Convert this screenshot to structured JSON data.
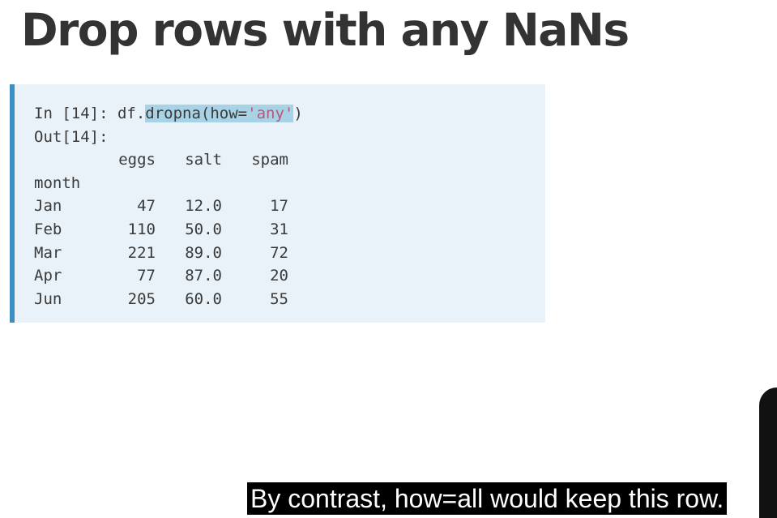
{
  "slide": {
    "title": "Drop rows with any NaNs"
  },
  "code": {
    "prompt": "In [14]: df.",
    "call_method": "dropna(how=",
    "call_arg": "'any'",
    "call_close": ")",
    "output_label": "Out[14]:",
    "index_name": "month",
    "columns": [
      "eggs",
      "salt",
      "spam"
    ],
    "rows": [
      {
        "month": "Jan",
        "eggs": "47",
        "salt": "12.0",
        "spam": "17"
      },
      {
        "month": "Feb",
        "eggs": "110",
        "salt": "50.0",
        "spam": "31"
      },
      {
        "month": "Mar",
        "eggs": "221",
        "salt": "89.0",
        "spam": "72"
      },
      {
        "month": "Apr",
        "eggs": "77",
        "salt": "87.0",
        "spam": "20"
      },
      {
        "month": "Jun",
        "eggs": "205",
        "salt": "60.0",
        "spam": "55"
      }
    ]
  },
  "captions": {
    "subtitle": "By contrast, how=all would keep this row."
  },
  "colors": {
    "code_background": "#e9f2f9",
    "code_accent_bar": "#3b8fc4",
    "selection_highlight": "#a8d3e6"
  }
}
